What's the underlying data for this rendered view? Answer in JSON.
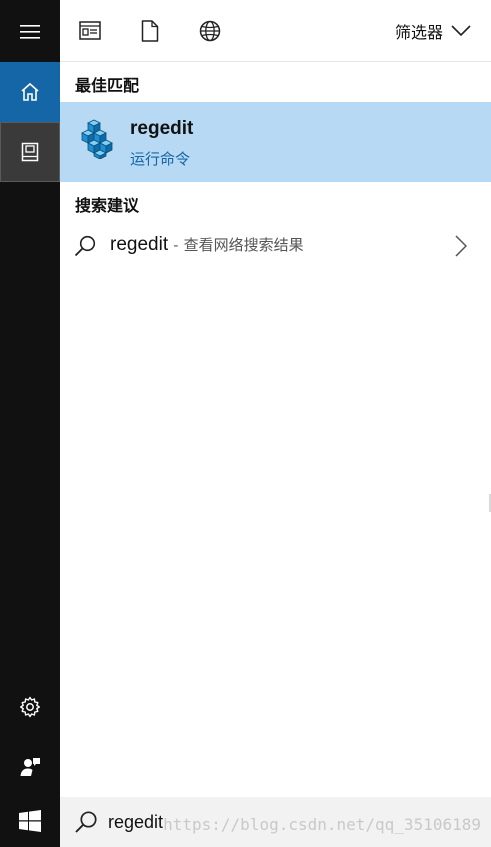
{
  "toolbar": {
    "filter_label": "筛选器",
    "icons": [
      "apps-icon",
      "document-icon",
      "globe-icon"
    ]
  },
  "sections": {
    "best_match_title": "最佳匹配",
    "suggestions_title": "搜索建议"
  },
  "best_match": {
    "name": "regedit",
    "subtitle": "运行命令",
    "icon": "registry-editor-icon"
  },
  "suggestion": {
    "query": "regedit",
    "separator": "-",
    "meta": "查看网络搜索结果"
  },
  "search": {
    "value": "regedit"
  },
  "watermark": "https://blog.csdn.net/qq_35106189",
  "colors": {
    "rail_bg": "#111111",
    "accent": "#1466a6",
    "selection_bg": "#b7d9f3",
    "searchbar_bg": "#f2f2f2"
  }
}
